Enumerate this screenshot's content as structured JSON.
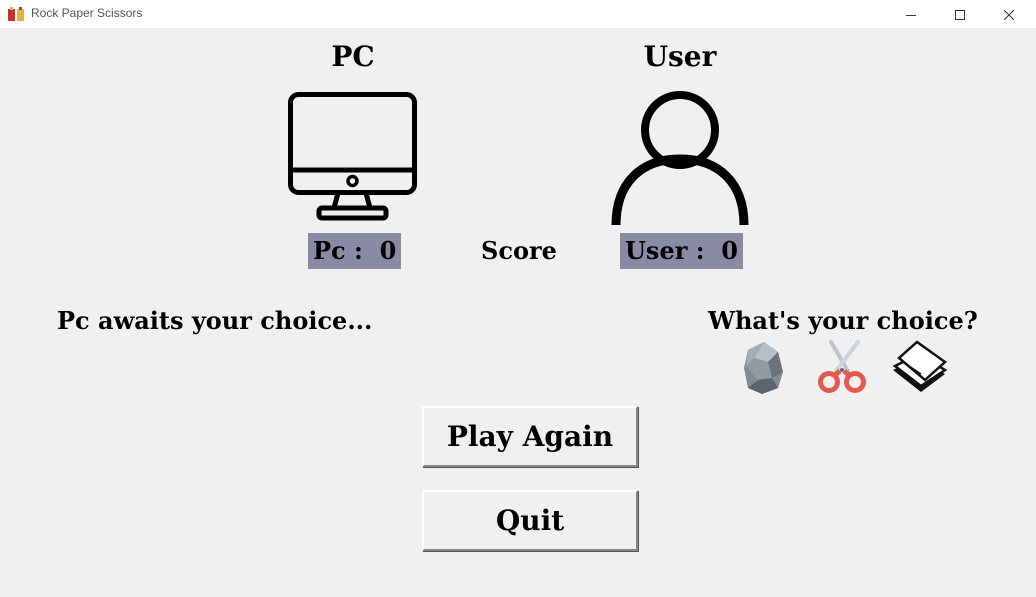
{
  "window": {
    "title": "Rock Paper Scissors",
    "icon": "rock-paper-scissors-app-icon",
    "controls": [
      "minimize-icon",
      "maximize-icon",
      "close-icon"
    ]
  },
  "pc": {
    "heading": "PC",
    "icon": "monitor-icon"
  },
  "user": {
    "heading": "User",
    "icon": "user-icon"
  },
  "score": {
    "label": "Score",
    "pc_text": "Pc :  0",
    "user_text": "User :  0",
    "pc_value": 0,
    "user_value": 0,
    "box_color": "#8a8aa4"
  },
  "status": {
    "message": "Pc awaits your choice..."
  },
  "choices": {
    "prompt": "What's your choice?",
    "options": [
      {
        "name": "rock",
        "icon": "rock-icon"
      },
      {
        "name": "scissors",
        "icon": "scissors-icon"
      },
      {
        "name": "paper",
        "icon": "paper-icon"
      }
    ]
  },
  "buttons": {
    "play_again": "Play Again",
    "quit": "Quit"
  }
}
